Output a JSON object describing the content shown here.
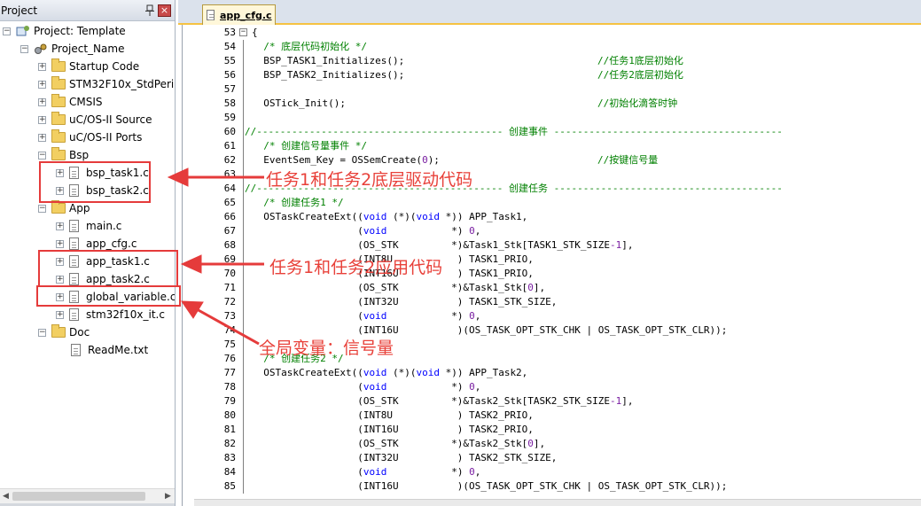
{
  "project_pane": {
    "title": "Project",
    "tree": [
      {
        "label": "Project: Template",
        "kind": "project",
        "expander": "−"
      },
      {
        "label": "Project_Name",
        "kind": "target"
      },
      {
        "label": "Startup Code",
        "kind": "folder",
        "expander": "+"
      },
      {
        "label": "STM32F10x_StdPeriph",
        "kind": "folder",
        "expander": "+"
      },
      {
        "label": "CMSIS",
        "kind": "folder",
        "expander": "+"
      },
      {
        "label": "uC/OS-II Source",
        "kind": "folder",
        "expander": "+"
      },
      {
        "label": "uC/OS-II Ports",
        "kind": "folder",
        "expander": "+"
      },
      {
        "label": "Bsp",
        "kind": "folder",
        "expander": "−"
      },
      {
        "label": "bsp_task1.c",
        "kind": "file",
        "expander": "+"
      },
      {
        "label": "bsp_task2.c",
        "kind": "file",
        "expander": "+"
      },
      {
        "label": "App",
        "kind": "folder",
        "expander": "−"
      },
      {
        "label": "main.c",
        "kind": "file",
        "expander": "+"
      },
      {
        "label": "app_cfg.c",
        "kind": "file",
        "expander": "+"
      },
      {
        "label": "app_task1.c",
        "kind": "file",
        "expander": "+"
      },
      {
        "label": "app_task2.c",
        "kind": "file",
        "expander": "+"
      },
      {
        "label": "global_variable.c",
        "kind": "file",
        "expander": "+"
      },
      {
        "label": "stm32f10x_it.c",
        "kind": "file",
        "expander": "+"
      },
      {
        "label": "Doc",
        "kind": "folder",
        "expander": "−"
      },
      {
        "label": "ReadMe.txt",
        "kind": "file"
      }
    ]
  },
  "editor": {
    "active_tab": "app_cfg.c",
    "lines": [
      {
        "n": "53",
        "fold": "−",
        "code": "{",
        "comment": ""
      },
      {
        "n": "54",
        "code": "",
        "comment": "  /* 底层代码初始化 */"
      },
      {
        "n": "55",
        "code": "  BSP_TASK1_Initializes();",
        "comment": "//任务1底层初始化"
      },
      {
        "n": "56",
        "code": "  BSP_TASK2_Initializes();",
        "comment": "//任务2底层初始化"
      },
      {
        "n": "57",
        "code": "",
        "comment": ""
      },
      {
        "n": "58",
        "code": "  OSTick_Init();",
        "comment": "//初始化滴答时钟"
      },
      {
        "n": "59",
        "code": "",
        "comment": ""
      },
      {
        "n": "60",
        "code": "",
        "comment": "//------------------------------------------ 创建事件 ---------------------------------------"
      },
      {
        "n": "61",
        "code": "",
        "comment": "  /* 创建信号量事件 */"
      },
      {
        "n": "62",
        "code": "  EventSem_Key = OSSemCreate(0);",
        "comment": "//按键信号量"
      },
      {
        "n": "63",
        "code": "",
        "comment": ""
      },
      {
        "n": "64",
        "code": "",
        "comment": "//------------------------------------------ 创建任务 ---------------------------------------"
      },
      {
        "n": "65",
        "code": "",
        "comment": "  /* 创建任务1 */"
      },
      {
        "n": "66",
        "code": "  OSTaskCreateExt((void (*)(void *)) APP_Task1,",
        "comment": ""
      },
      {
        "n": "67",
        "code": "                  (void           *) 0,",
        "comment": ""
      },
      {
        "n": "68",
        "code": "                  (OS_STK         *)&Task1_Stk[TASK1_STK_SIZE-1],",
        "comment": ""
      },
      {
        "n": "69",
        "code": "                  (INT8U           ) TASK1_PRIO,",
        "comment": ""
      },
      {
        "n": "70",
        "code": "                  (INT16U          ) TASK1_PRIO,",
        "comment": ""
      },
      {
        "n": "71",
        "code": "                  (OS_STK         *)&Task1_Stk[0],",
        "comment": ""
      },
      {
        "n": "72",
        "code": "                  (INT32U          ) TASK1_STK_SIZE,",
        "comment": ""
      },
      {
        "n": "73",
        "code": "                  (void           *) 0,",
        "comment": ""
      },
      {
        "n": "74",
        "code": "                  (INT16U          )(OS_TASK_OPT_STK_CHK | OS_TASK_OPT_STK_CLR));",
        "comment": ""
      },
      {
        "n": "75",
        "code": "",
        "comment": ""
      },
      {
        "n": "76",
        "code": "",
        "comment": "  /* 创建任务2 */"
      },
      {
        "n": "77",
        "code": "  OSTaskCreateExt((void (*)(void *)) APP_Task2,",
        "comment": ""
      },
      {
        "n": "78",
        "code": "                  (void           *) 0,",
        "comment": ""
      },
      {
        "n": "79",
        "code": "                  (OS_STK         *)&Task2_Stk[TASK2_STK_SIZE-1],",
        "comment": ""
      },
      {
        "n": "80",
        "code": "                  (INT8U           ) TASK2_PRIO,",
        "comment": ""
      },
      {
        "n": "81",
        "code": "                  (INT16U          ) TASK2_PRIO,",
        "comment": ""
      },
      {
        "n": "82",
        "code": "                  (OS_STK         *)&Task2_Stk[0],",
        "comment": ""
      },
      {
        "n": "83",
        "code": "                  (INT32U          ) TASK2_STK_SIZE,",
        "comment": ""
      },
      {
        "n": "84",
        "code": "                  (void           *) 0,",
        "comment": ""
      },
      {
        "n": "85",
        "code": "                  (INT16U          )(OS_TASK_OPT_STK_CHK | OS_TASK_OPT_STK_CLR));",
        "comment": ""
      }
    ]
  },
  "annotations": {
    "bsp": "任务1和任务2底层驱动代码",
    "app": "任务1和任务2应用代码",
    "global": "全局变量：信号量"
  },
  "colors": {
    "annotation_red": "#e53b3b",
    "comment_green": "#008000",
    "keyword_blue": "#0000ff",
    "tab_accent": "#f5c242"
  }
}
